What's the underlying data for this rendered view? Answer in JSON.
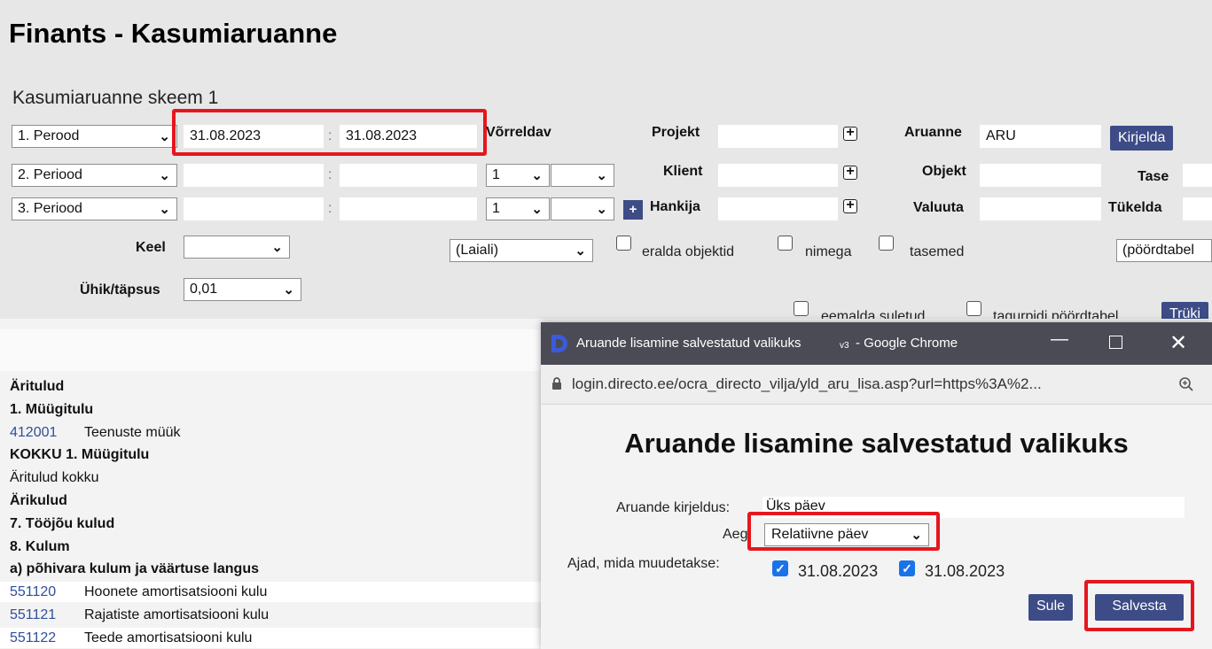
{
  "page": {
    "title": "Finants - Kasumiaruanne",
    "scheme_title": "Kasumiaruanne skeem 1"
  },
  "filters": {
    "period1": {
      "select": "1. Perood",
      "from": "31.08.2023",
      "to": "31.08.2023"
    },
    "period2": {
      "select": "2. Periood",
      "from": "",
      "to": "",
      "num": "1",
      "num2": ""
    },
    "period3": {
      "select": "3. Periood",
      "from": "",
      "to": "",
      "num": "1",
      "num2": ""
    },
    "colon": ":",
    "vorreldav_label": "Võrreldav",
    "projekt_label": "Projekt",
    "klient_label": "Klient",
    "hankija_label": "Hankija",
    "aruanne_label": "Aruanne",
    "aruanne_value": "ARU",
    "objekt_label": "Objekt",
    "valuuta_label": "Valuuta",
    "tase_label": "Tase",
    "tukelda_label": "Tükelda",
    "kirjelda_button": "Kirjelda",
    "keel_label": "Keel",
    "keel_value": "",
    "laiali_value": "(Laiali)",
    "eralda_objektid": "eralda objektid",
    "nimega": "nimega",
    "tasemed": "tasemed",
    "poordtabel_value": "(pöördtabel",
    "uhik_label": "Ühik/täpsus",
    "uhik_value": "0,01",
    "eemalda_suletud": "eemalda suletud",
    "tagurpidi": "tagurpidi pöördtabel",
    "truki_button": "Trüki",
    "plus_sign": "+"
  },
  "report": {
    "rows": [
      {
        "type": "bold",
        "text": "Äritulud"
      },
      {
        "type": "bold",
        "text": "1. Müügitulu"
      },
      {
        "type": "account",
        "code": "412001",
        "text": "Teenuste müük"
      },
      {
        "type": "bold",
        "text": "KOKKU 1. Müügitulu"
      },
      {
        "type": "normal",
        "text": "Äritulud kokku"
      },
      {
        "type": "bold",
        "text": "Ärikulud"
      },
      {
        "type": "bold",
        "text": "7. Tööjõu kulud"
      },
      {
        "type": "bold",
        "text": "8. Kulum"
      },
      {
        "type": "bold",
        "text": "a) põhivara kulum ja väärtuse langus"
      },
      {
        "type": "account",
        "code": "551120",
        "text": "Hoonete amortisatsiooni kulu"
      },
      {
        "type": "account",
        "code": "551121",
        "text": "Rajatiste amortisatsiooni kulu"
      },
      {
        "type": "account",
        "code": "551122",
        "text": "Teede amortisatsiooni kulu"
      }
    ]
  },
  "popup": {
    "window_title": "Aruande lisamine salvestatud valikuks",
    "window_title_version": "v3",
    "window_title_app": "- Google Chrome",
    "url": "login.directo.ee/ocra_directo_vilja/yld_aru_lisa.asp?url=https%3A%2...",
    "heading": "Aruande lisamine salvestatud valikuks",
    "kirjeldus_label": "Aruande kirjeldus:",
    "kirjeldus_value": "Üks päev",
    "aeg_label": "Aeg:",
    "aeg_value": "Relatiivne päev",
    "ajad_label": "Ajad, mida muudetakse:",
    "date1": "31.08.2023",
    "date2": "31.08.2023",
    "sule_button": "Sule",
    "salvesta_button": "Salvesta"
  },
  "colors": {
    "accent_button": "#3d4c86",
    "highlight_red": "#e5161e",
    "link_blue": "#2f4f9a",
    "titlebar": "#4b4b55"
  }
}
